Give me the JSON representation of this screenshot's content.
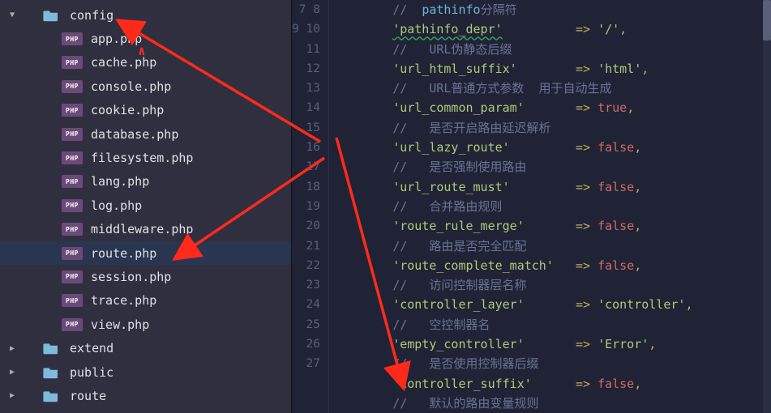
{
  "sidebar": {
    "folders": [
      {
        "name": "config",
        "expanded": true,
        "indent": 26,
        "chev": "▼"
      },
      {
        "name": "extend",
        "expanded": false,
        "indent": 26,
        "chev": "▶"
      },
      {
        "name": "public",
        "expanded": false,
        "indent": 26,
        "chev": "▶"
      },
      {
        "name": "route",
        "expanded": false,
        "indent": 26,
        "chev": "▶"
      }
    ],
    "files": [
      {
        "name": "app.php"
      },
      {
        "name": "cache.php"
      },
      {
        "name": "console.php"
      },
      {
        "name": "cookie.php"
      },
      {
        "name": "database.php"
      },
      {
        "name": "filesystem.php"
      },
      {
        "name": "lang.php"
      },
      {
        "name": "log.php"
      },
      {
        "name": "middleware.php"
      },
      {
        "name": "route.php",
        "selected": true
      },
      {
        "name": "session.php"
      },
      {
        "name": "trace.php"
      },
      {
        "name": "view.php"
      }
    ]
  },
  "gutter": {
    "start": 7,
    "end": 27
  },
  "icons": {
    "php_badge": "PHP",
    "folder_color": "#7fbada",
    "arrow_color": "#ff2a1a"
  },
  "code_lines": [
    {
      "type": "comment",
      "text": "//  ",
      "fn": "pathinfo",
      "tail": "分隔符"
    },
    {
      "type": "kv",
      "key": "'pathinfo_depr'",
      "pad": 10,
      "arrow": "=>",
      "val_str": "'/'",
      "comma": ",",
      "spell": true
    },
    {
      "type": "comment2",
      "text": "//   URL伪静态后缀"
    },
    {
      "type": "kv",
      "key": "'url_html_suffix'",
      "pad": 8,
      "arrow": "=>",
      "val_str": "'html'",
      "comma": ","
    },
    {
      "type": "comment2",
      "text": "//   URL普通方式参数  用于自动生成"
    },
    {
      "type": "kv",
      "key": "'url_common_param'",
      "pad": 7,
      "arrow": "=>",
      "val_bool": "true",
      "comma": ","
    },
    {
      "type": "comment2",
      "text": "//   是否开启路由延迟解析"
    },
    {
      "type": "kv",
      "key": "'url_lazy_route'",
      "pad": 9,
      "arrow": "=>",
      "val_bool": "false",
      "comma": ","
    },
    {
      "type": "comment2",
      "text": "//   是否强制使用路由"
    },
    {
      "type": "kv",
      "key": "'url_route_must'",
      "pad": 9,
      "arrow": "=>",
      "val_bool": "false",
      "comma": ","
    },
    {
      "type": "comment2",
      "text": "//   合并路由规则"
    },
    {
      "type": "kv",
      "key": "'route_rule_merge'",
      "pad": 7,
      "arrow": "=>",
      "val_bool": "false",
      "comma": ","
    },
    {
      "type": "comment2",
      "text": "//   路由是否完全匹配"
    },
    {
      "type": "kv",
      "key": "'route_complete_match'",
      "pad": 3,
      "arrow": "=>",
      "val_bool": "false",
      "comma": ","
    },
    {
      "type": "comment2",
      "text": "//   访问控制器层名称"
    },
    {
      "type": "kv",
      "key": "'controller_layer'",
      "pad": 7,
      "arrow": "=>",
      "val_str": "'controller'",
      "comma": ","
    },
    {
      "type": "comment2",
      "text": "//   空控制器名"
    },
    {
      "type": "kv",
      "key": "'empty_controller'",
      "pad": 7,
      "arrow": "=>",
      "val_str": "'Error'",
      "comma": ","
    },
    {
      "type": "comment2",
      "text": "//   是否使用控制器后缀"
    },
    {
      "type": "kv",
      "key": "'controller_suffix'",
      "pad": 6,
      "arrow": "=>",
      "val_bool": "false",
      "comma": ","
    },
    {
      "type": "comment2",
      "text": "//   默认的路由变量规则"
    }
  ]
}
